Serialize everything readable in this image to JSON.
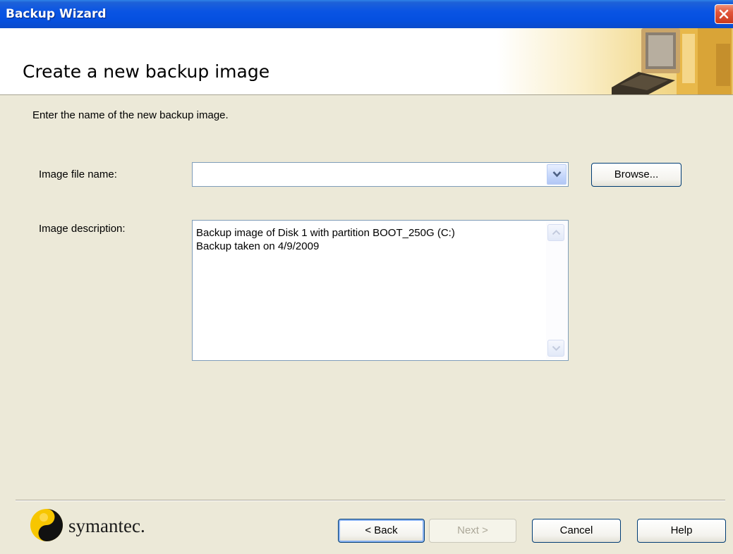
{
  "window": {
    "title": "Backup Wizard"
  },
  "header": {
    "title": "Create a new backup image"
  },
  "main": {
    "instruction": "Enter the name of the new backup image.",
    "image_file": {
      "label": "Image file name:",
      "value": ""
    },
    "browse_label": "Browse...",
    "image_description": {
      "label": "Image description:",
      "value": "Backup image of Disk 1 with partition BOOT_250G (C:)\nBackup taken on 4/9/2009"
    }
  },
  "footer": {
    "logo_text": "symantec.",
    "back_label": "< Back",
    "next_label": "Next >",
    "cancel_label": "Cancel",
    "help_label": "Help"
  },
  "colors": {
    "titlebar": "#0A54E3",
    "dialog_bg": "#ECE9D8",
    "logo_yellow": "#F7C600",
    "close_red": "#E2553A"
  },
  "icons": {
    "close": "close-icon",
    "dropdown": "chevron-down-icon",
    "scroll_up": "scroll-up-icon",
    "scroll_down": "scroll-down-icon",
    "header_art": "computer-illustration-icon",
    "logo": "symantec-logo-icon"
  }
}
